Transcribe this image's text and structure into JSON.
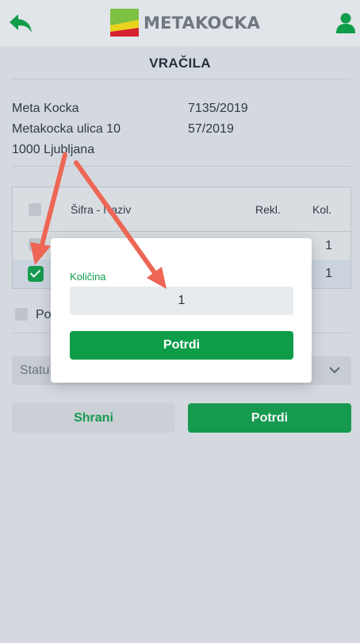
{
  "header": {
    "brand": "METAKOCKA",
    "back_icon": "back-arrow-icon",
    "user_icon": "user-icon",
    "colors": {
      "logo_green": "#7cc142",
      "logo_yellow": "#e8d21c",
      "logo_red": "#d5232f"
    }
  },
  "page": {
    "title": "VRAČILA"
  },
  "info": {
    "left": [
      "Meta Kocka",
      "Metakocka ulica 10",
      "1000 Ljubljana"
    ],
    "right": [
      "7135/2019",
      "57/2019"
    ]
  },
  "table": {
    "columns": {
      "code_name": "Šifra - Naziv",
      "rekl": "Rekl.",
      "kol": "Kol."
    },
    "rows": [
      {
        "qty": "1",
        "checked": false
      },
      {
        "qty": "1",
        "checked": true
      }
    ]
  },
  "option_partial": "Po",
  "status": {
    "placeholder_partial": "Statu"
  },
  "buttons": {
    "save": "Shrani",
    "confirm": "Potrdi"
  },
  "modal": {
    "label": "Količina",
    "value": "1",
    "confirm": "Potrdi"
  },
  "colors": {
    "accent": "#0f9d4a",
    "annotation_arrow": "#ee6655"
  }
}
